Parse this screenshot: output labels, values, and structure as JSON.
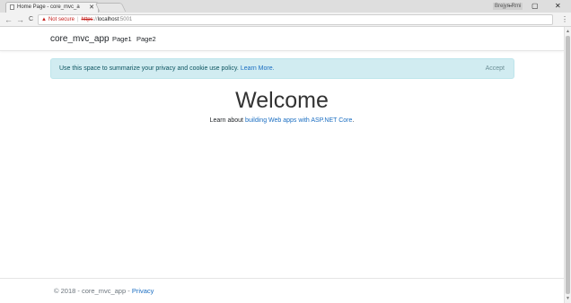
{
  "browser": {
    "tab_title": "Home Page - core_mvc_a",
    "tab_close": "✕",
    "profile_name": "Brejyn Rmi",
    "window_controls": {
      "minimize": "–",
      "maximize": "▢",
      "close": "✕"
    },
    "nav": {
      "back": "←",
      "forward": "→",
      "reload": "C"
    },
    "address": {
      "warning_icon": "▲",
      "not_secure": "Not secure",
      "separator": "|",
      "scheme": "https",
      "scheme_sep": "://",
      "host": "localhost",
      "port": ":5001"
    },
    "bookmark_icon": "☆",
    "menu_icon": "⋮"
  },
  "site": {
    "brand": "core_mvc_app",
    "nav_items": [
      {
        "label": "Page1"
      },
      {
        "label": "Page2"
      }
    ]
  },
  "consent": {
    "message": "Use this space to summarize your privacy and cookie use policy.",
    "link": "Learn More.",
    "accept": "Accept"
  },
  "main": {
    "heading": "Welcome",
    "learn_prefix": "Learn about",
    "learn_link": "building Web apps with ASP.NET Core",
    "learn_suffix": "."
  },
  "footer": {
    "copyright": "© 2018 - core_mvc_app -",
    "privacy": "Privacy"
  },
  "colors": {
    "link": "#1b6ec2",
    "alert_bg": "#d1ecf1",
    "alert_text": "#0c5460",
    "danger": "#c5221f"
  }
}
